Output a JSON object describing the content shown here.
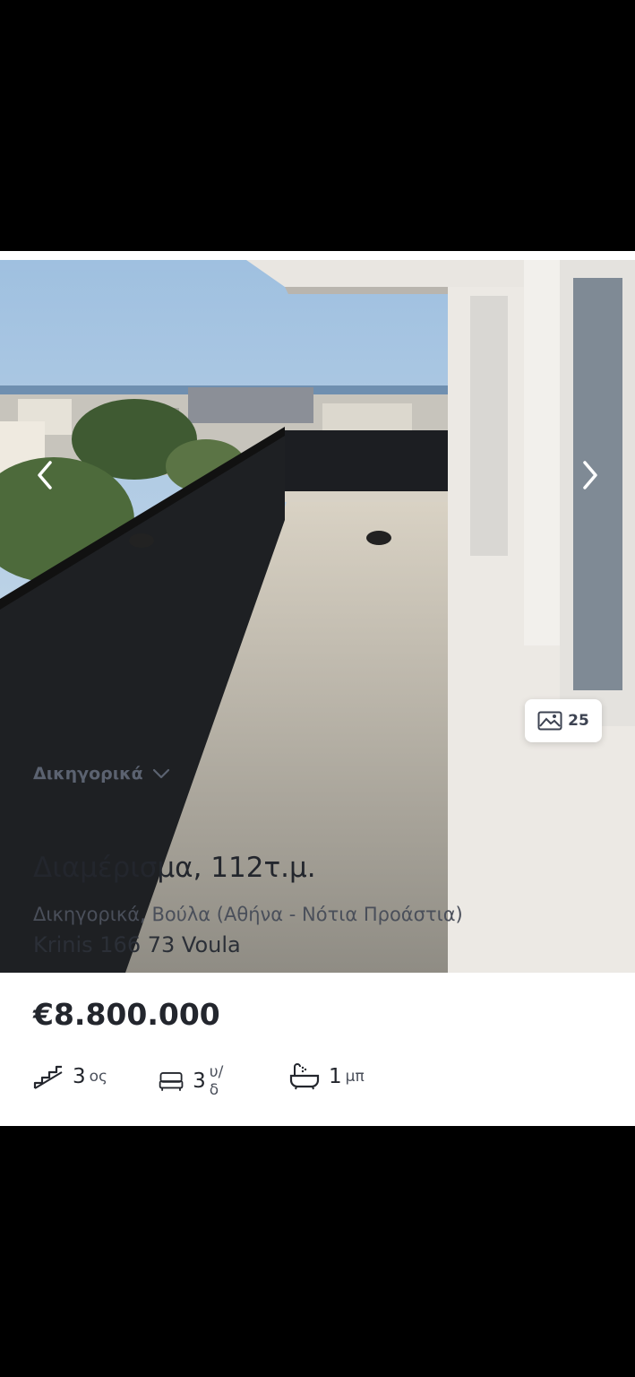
{
  "listing": {
    "photo_count": "25",
    "area_dropdown": "Δικηγορικά",
    "title": "Διαμέρισμα, 112τ.μ.",
    "location": "Δικηγορικά, Βούλα (Αθήνα - Νότια Προάστια)",
    "address": "Krinis 166 73 Voula",
    "price": "€8.800.000",
    "features": {
      "floors_num": "3",
      "floors_unit": "ος",
      "bedrooms_num": "3",
      "bedrooms_unit": "υ/δ",
      "bathrooms_num": "1",
      "bathrooms_unit": "μπ"
    }
  },
  "icons": {
    "prev": "chevron-left-icon",
    "next": "chevron-right-icon",
    "gallery": "image-icon",
    "dropdown": "chevron-down-icon",
    "floors": "stairs-icon",
    "bedrooms": "bed-icon",
    "bathrooms": "bathtub-icon"
  },
  "colors": {
    "text_primary": "#23262d",
    "text_secondary": "#4a4f5a",
    "background": "#000000"
  }
}
